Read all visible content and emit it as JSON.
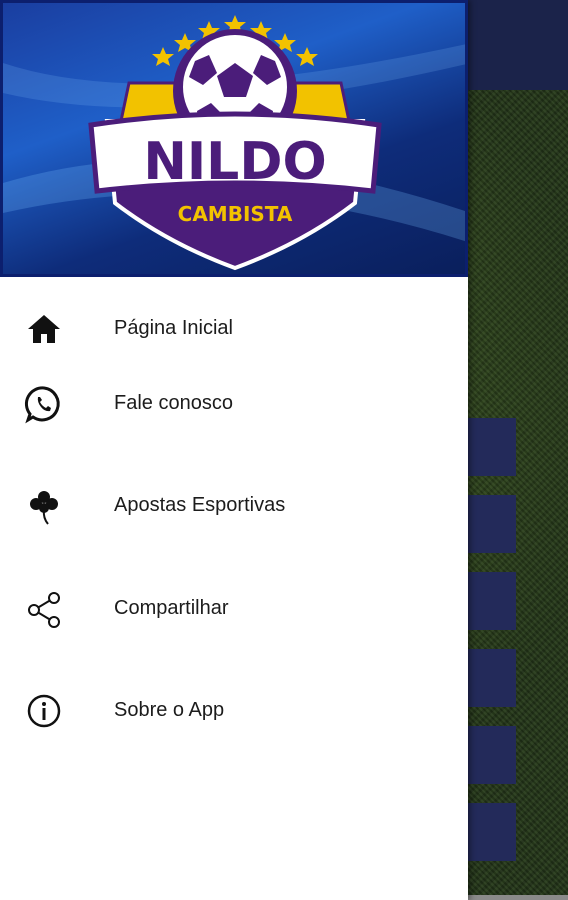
{
  "header": {
    "logo_title": "NILDO",
    "logo_subtitle": "CAMBISTA",
    "colors": {
      "purple": "#4b1d7a",
      "gold": "#f2c200",
      "blue": "#1f5fc8"
    }
  },
  "menu": {
    "items": [
      {
        "label": "Página Inicial",
        "icon": "home-icon"
      },
      {
        "label": "Fale conosco",
        "icon": "whatsapp-icon"
      },
      {
        "label": "Apostas Esportivas",
        "icon": "clover-icon"
      },
      {
        "label": "Compartilhar",
        "icon": "share-icon"
      },
      {
        "label": "Sobre o App",
        "icon": "info-icon"
      }
    ]
  }
}
